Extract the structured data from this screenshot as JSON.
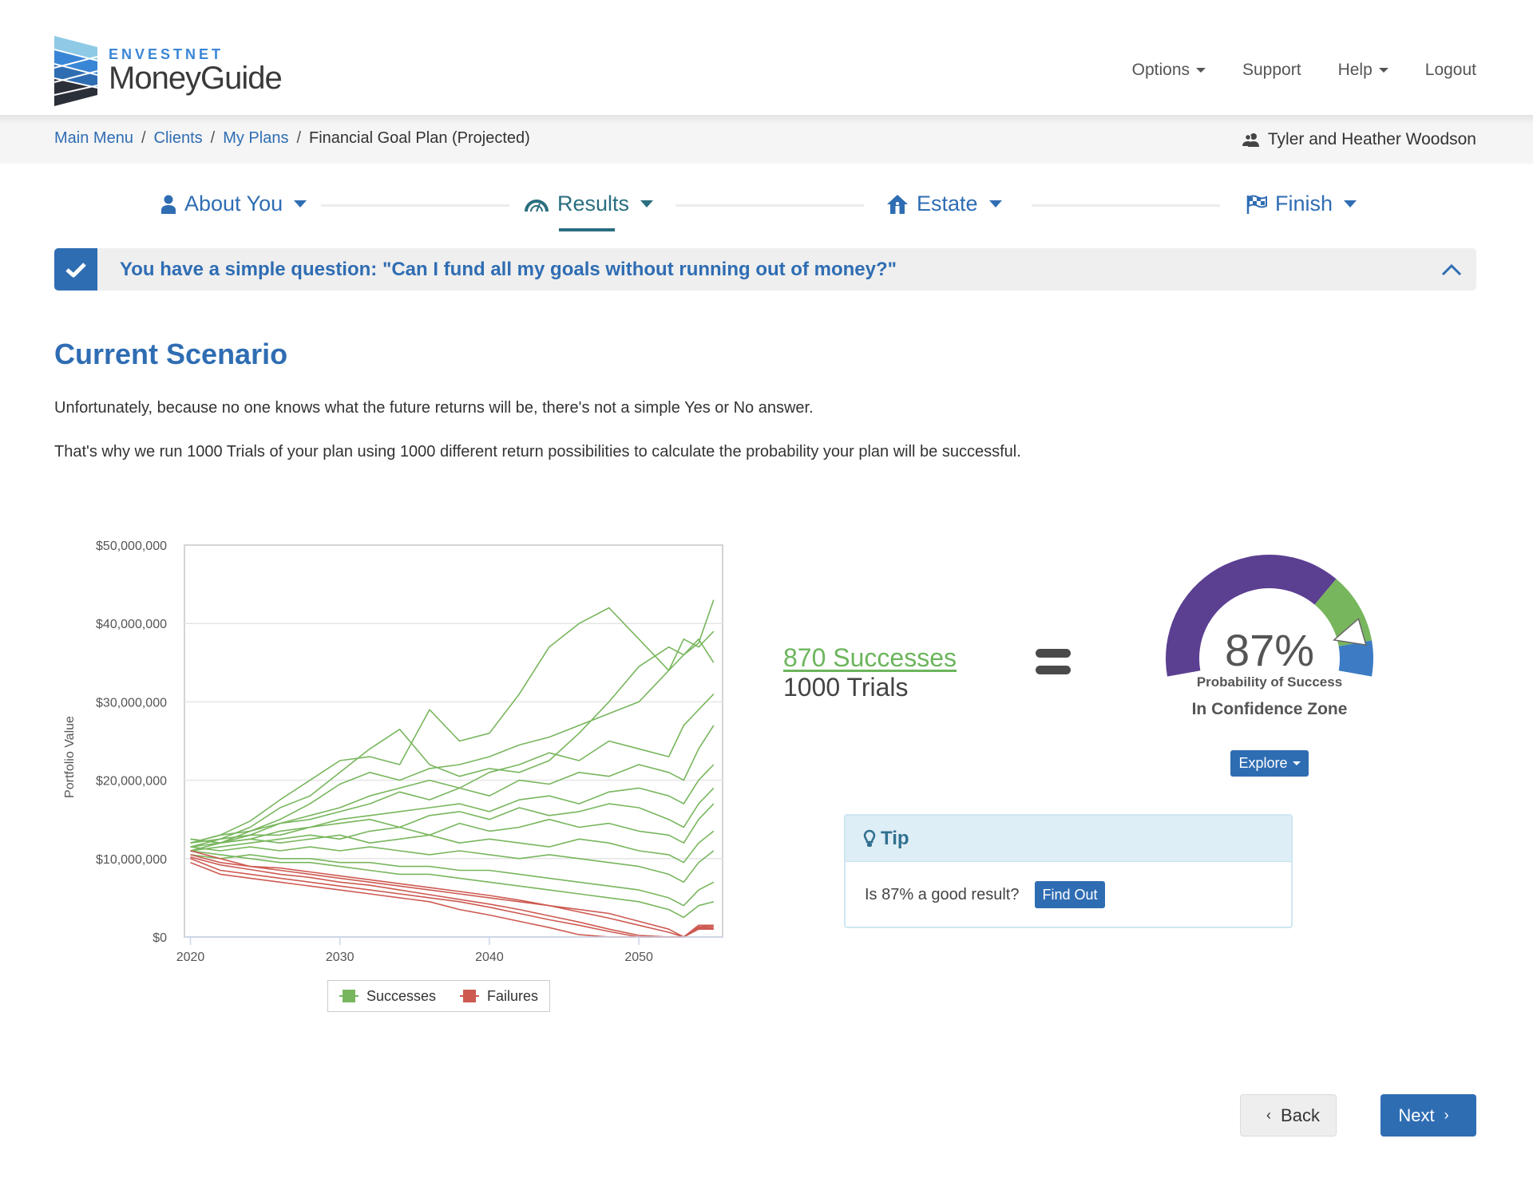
{
  "app": {
    "brand": "ENVESTNET",
    "product": "MoneyGuide"
  },
  "topnav": {
    "items": [
      {
        "label": "Options",
        "has_dropdown": true
      },
      {
        "label": "Support",
        "has_dropdown": false
      },
      {
        "label": "Help",
        "has_dropdown": true
      },
      {
        "label": "Logout",
        "has_dropdown": false
      }
    ]
  },
  "breadcrumb": {
    "items": [
      {
        "label": "Main Menu",
        "link": true
      },
      {
        "label": "Clients",
        "link": true
      },
      {
        "label": "My Plans",
        "link": true
      },
      {
        "label": "Financial Goal Plan (Projected)",
        "link": false
      }
    ],
    "separator": "/"
  },
  "client": {
    "name": "Tyler and Heather Woodson",
    "icon": "users-icon"
  },
  "stepper": {
    "steps": [
      {
        "label": "About You",
        "icon": "user-icon",
        "active": false
      },
      {
        "label": "Results",
        "icon": "gauge-icon",
        "active": true
      },
      {
        "label": "Estate",
        "icon": "home-icon",
        "active": false
      },
      {
        "label": "Finish",
        "icon": "flag-checkered-icon",
        "active": false
      }
    ]
  },
  "banner": {
    "text": "You have a simple question: \"Can I fund all my goals without running out of money?\"",
    "icon": "check-icon",
    "toggle_icon": "chevron-up-icon"
  },
  "main": {
    "title": "Current Scenario",
    "paragraphs": [
      "Unfortunately, because no one knows what the future returns will be, there's not a simple Yes or No answer.",
      "That's why we run 1000 Trials of your plan using 1000 different return possibilities to calculate the probability your plan will be successful."
    ]
  },
  "results": {
    "successes_label": "870 Successes",
    "trials_label": "1000 Trials",
    "successes": 870,
    "trials": 1000
  },
  "gauge": {
    "value_label": "87%",
    "value": 0.87,
    "caption": "Probability of Success",
    "zone_label": "In Confidence Zone",
    "zones": [
      {
        "name": "below",
        "from": 0,
        "to": 0.7,
        "color": "#5b3f91"
      },
      {
        "name": "confidence",
        "from": 0.7,
        "to": 0.9,
        "color": "#78b65d"
      },
      {
        "name": "above",
        "from": 0.9,
        "to": 1.0,
        "color": "#3d7cc4"
      }
    ],
    "explore_label": "Explore"
  },
  "tip": {
    "title": "Tip",
    "icon": "lightbulb-icon",
    "question": "Is 87% a good result?",
    "button_label": "Find Out"
  },
  "footer": {
    "back_label": "Back",
    "next_label": "Next"
  },
  "colors": {
    "primary": "#2f6db3",
    "results_teal": "#2a6e80",
    "success": "#78b65d",
    "failure": "#cd5a52"
  },
  "chart_data": {
    "type": "line",
    "title": "",
    "xlabel": "",
    "ylabel": "Portfolio Value",
    "xlim": [
      2019.6,
      2055.6
    ],
    "ylim": [
      0,
      50000000
    ],
    "x_ticks": [
      2020,
      2030,
      2040,
      2050
    ],
    "x_tick_labels": [
      "2020",
      "2030",
      "2040",
      "2050"
    ],
    "y_ticks": [
      0,
      10000000,
      20000000,
      30000000,
      40000000,
      50000000
    ],
    "y_tick_labels": [
      "$0",
      "$10,000,000",
      "$20,000,000",
      "$30,000,000",
      "$40,000,000",
      "$50,000,000"
    ],
    "grid": true,
    "legend": {
      "position": "bottom",
      "entries": [
        {
          "name": "Successes",
          "color": "#78b65d"
        },
        {
          "name": "Failures",
          "color": "#cd5a52"
        }
      ]
    },
    "note": "Monte Carlo trial paths; representative traced series below (actual chart shows many overlapping trials).",
    "x": [
      2020,
      2022,
      2024,
      2026,
      2028,
      2030,
      2032,
      2034,
      2036,
      2038,
      2040,
      2042,
      2044,
      2046,
      2048,
      2050,
      2052,
      2053,
      2054,
      2055
    ],
    "series": [
      {
        "name": "Successes",
        "group": "success",
        "values": [
          12000000,
          13000000,
          14800000,
          17500000,
          20000000,
          22500000,
          23000000,
          22000000,
          29000000,
          25000000,
          26000000,
          31000000,
          37000000,
          40000000,
          42000000,
          38000000,
          34000000,
          36000000,
          37500000,
          43000000
        ]
      },
      {
        "name": "Successes",
        "group": "success",
        "values": [
          11500000,
          12500000,
          14000000,
          16500000,
          18000000,
          21000000,
          24000000,
          26500000,
          22000000,
          20500000,
          21500000,
          21000000,
          22500000,
          26000000,
          30000000,
          34500000,
          37000000,
          36000000,
          38000000,
          35000000
        ]
      },
      {
        "name": "Successes",
        "group": "success",
        "values": [
          12500000,
          12000000,
          13500000,
          15000000,
          17000000,
          19500000,
          21000000,
          20000000,
          21500000,
          22000000,
          23000000,
          24500000,
          25500000,
          27000000,
          28500000,
          30000000,
          34000000,
          38000000,
          37000000,
          39000000
        ]
      },
      {
        "name": "Successes",
        "group": "success",
        "values": [
          11000000,
          12000000,
          13000000,
          14500000,
          15500000,
          16500000,
          18000000,
          19000000,
          20000000,
          19000000,
          21000000,
          22000000,
          23500000,
          22500000,
          25000000,
          24000000,
          23000000,
          27000000,
          29000000,
          31000000
        ]
      },
      {
        "name": "Successes",
        "group": "success",
        "values": [
          12000000,
          13000000,
          13500000,
          14500000,
          15000000,
          16000000,
          17000000,
          18500000,
          17500000,
          19000000,
          18000000,
          20000000,
          19500000,
          21000000,
          20500000,
          22000000,
          21000000,
          20000000,
          24000000,
          27000000
        ]
      },
      {
        "name": "Successes",
        "group": "success",
        "values": [
          11500000,
          12000000,
          12500000,
          13500000,
          14000000,
          15000000,
          15500000,
          16000000,
          16500000,
          17000000,
          16000000,
          17500000,
          18000000,
          17000000,
          18500000,
          19000000,
          18000000,
          17000000,
          20000000,
          22000000
        ]
      },
      {
        "name": "Successes",
        "group": "success",
        "values": [
          12000000,
          12500000,
          13000000,
          13000000,
          14000000,
          14500000,
          15000000,
          14000000,
          15500000,
          16000000,
          15000000,
          16500000,
          15500000,
          16000000,
          17000000,
          16500000,
          15000000,
          14000000,
          17000000,
          19000000
        ]
      },
      {
        "name": "Successes",
        "group": "success",
        "values": [
          11000000,
          11500000,
          12000000,
          12500000,
          13000000,
          12500000,
          13500000,
          14000000,
          13000000,
          14500000,
          13500000,
          14000000,
          15000000,
          14000000,
          14500000,
          13500000,
          13000000,
          12000000,
          15000000,
          17000000
        ]
      },
      {
        "name": "Successes",
        "group": "success",
        "values": [
          12500000,
          12000000,
          12500000,
          12000000,
          12500000,
          13000000,
          12000000,
          12500000,
          13000000,
          12000000,
          12500000,
          12000000,
          11500000,
          12500000,
          12000000,
          11000000,
          10500000,
          9500000,
          12000000,
          13500000
        ]
      },
      {
        "name": "Successes",
        "group": "success",
        "values": [
          11500000,
          11000000,
          11500000,
          11000000,
          11500000,
          11000000,
          11500000,
          11000000,
          10500000,
          11000000,
          10500000,
          10000000,
          10500000,
          10000000,
          9500000,
          9000000,
          8000000,
          7000000,
          9500000,
          11000000
        ]
      },
      {
        "name": "Successes",
        "group": "success",
        "values": [
          10500000,
          10000000,
          10500000,
          10000000,
          10000000,
          9500000,
          9500000,
          9000000,
          9000000,
          8500000,
          8500000,
          8000000,
          7500000,
          7000000,
          6500000,
          6000000,
          5000000,
          4000000,
          6000000,
          7000000
        ]
      },
      {
        "name": "Successes",
        "group": "success",
        "values": [
          11000000,
          10500000,
          10000000,
          9500000,
          9500000,
          9000000,
          8500000,
          8000000,
          8000000,
          7500000,
          7000000,
          6500000,
          6000000,
          5500000,
          5000000,
          4500000,
          3500000,
          2500000,
          4000000,
          4500000
        ]
      },
      {
        "name": "Failures",
        "group": "failure",
        "values": [
          10500000,
          9500000,
          9000000,
          8500000,
          8000000,
          7500000,
          7000000,
          6500000,
          6000000,
          5500000,
          5000000,
          4500000,
          4000000,
          3500000,
          3000000,
          2000000,
          1000000,
          0,
          1500000,
          1500000
        ]
      },
      {
        "name": "Failures",
        "group": "failure",
        "values": [
          10000000,
          8500000,
          8000000,
          7500000,
          7000000,
          6500000,
          6000000,
          5500000,
          5000000,
          4500000,
          3800000,
          3000000,
          2200000,
          1500000,
          700000,
          0,
          0,
          0,
          1200000,
          1200000
        ]
      },
      {
        "name": "Failures",
        "group": "failure",
        "values": [
          9500000,
          8000000,
          7500000,
          7000000,
          6500000,
          6000000,
          5500000,
          5000000,
          4500000,
          3500000,
          2800000,
          2000000,
          1200000,
          300000,
          0,
          0,
          0,
          0,
          1000000,
          1000000
        ]
      },
      {
        "name": "Failures",
        "group": "failure",
        "values": [
          11000000,
          10000000,
          9000000,
          8800000,
          8300000,
          7800000,
          7300000,
          6800000,
          6300000,
          5800000,
          5300000,
          4700000,
          4000000,
          3200000,
          2400000,
          1500000,
          600000,
          0,
          1300000,
          1400000
        ]
      },
      {
        "name": "Failures",
        "group": "failure",
        "values": [
          10200000,
          9200000,
          8600000,
          8000000,
          7600000,
          7000000,
          6600000,
          6000000,
          5400000,
          4800000,
          4200000,
          3500000,
          2700000,
          1900000,
          1000000,
          200000,
          0,
          0,
          1100000,
          1100000
        ]
      }
    ]
  }
}
